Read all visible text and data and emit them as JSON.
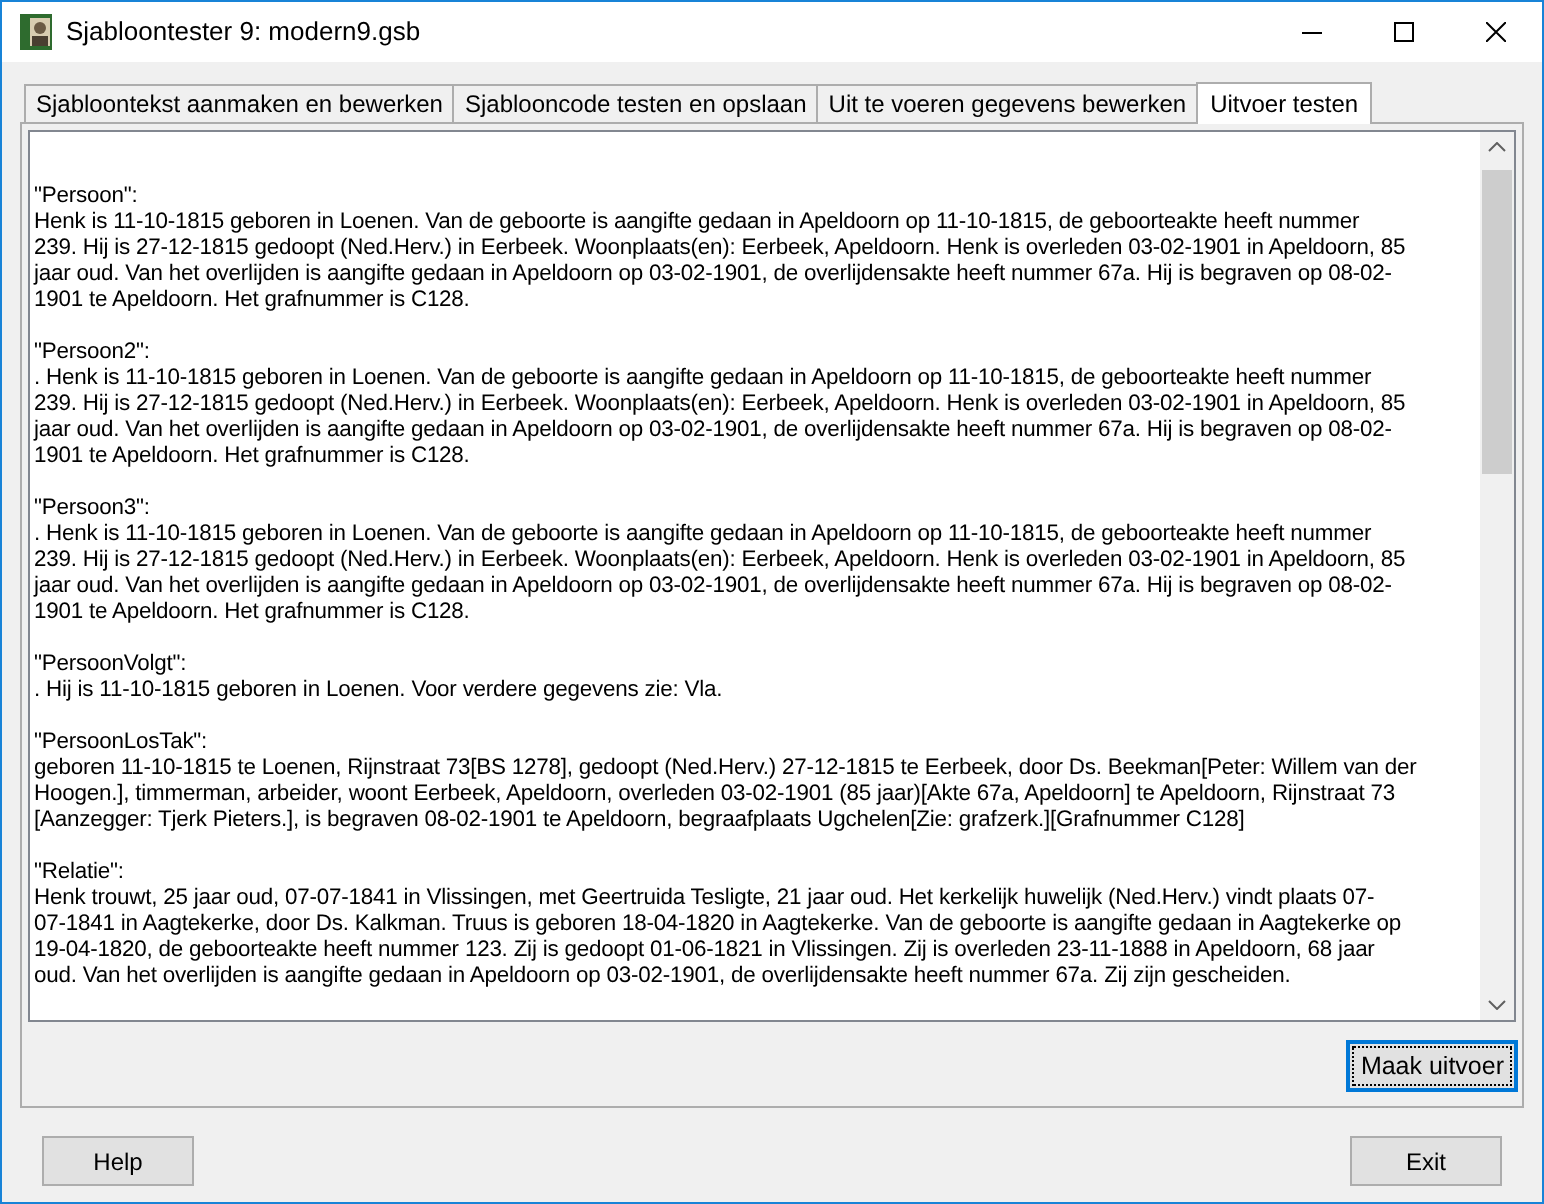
{
  "window": {
    "title": "Sjabloontester 9: modern9.gsb"
  },
  "tabs": [
    {
      "label": "Sjabloontekst aanmaken en bewerken",
      "selected": false
    },
    {
      "label": "Sjablooncode testen en opslaan",
      "selected": false
    },
    {
      "label": "Uit te voeren gegevens bewerken",
      "selected": false
    },
    {
      "label": "Uitvoer testen",
      "selected": true
    }
  ],
  "output": [
    {
      "heading": "\"Persoon\":",
      "lines": [
        "Henk is 11-10-1815 geboren in Loenen. Van de geboorte is aangifte gedaan in Apeldoorn op 11-10-1815, de geboorteakte heeft nummer",
        "239. Hij is 27-12-1815 gedoopt (Ned.Herv.) in Eerbeek. Woonplaats(en): Eerbeek, Apeldoorn. Henk is overleden 03-02-1901 in Apeldoorn, 85",
        "jaar oud. Van het overlijden is aangifte gedaan in Apeldoorn op 03-02-1901, de overlijdensakte heeft nummer 67a. Hij is begraven op 08-02-",
        "1901 te Apeldoorn. Het grafnummer is C128."
      ]
    },
    {
      "heading": "\"Persoon2\":",
      "lines": [
        ". Henk is 11-10-1815 geboren in Loenen. Van de geboorte is aangifte gedaan in Apeldoorn op 11-10-1815, de geboorteakte heeft nummer",
        "239. Hij is 27-12-1815 gedoopt (Ned.Herv.) in Eerbeek. Woonplaats(en): Eerbeek, Apeldoorn. Henk is overleden 03-02-1901 in Apeldoorn, 85",
        "jaar oud. Van het overlijden is aangifte gedaan in Apeldoorn op 03-02-1901, de overlijdensakte heeft nummer 67a. Hij is begraven op 08-02-",
        "1901 te Apeldoorn. Het grafnummer is C128."
      ]
    },
    {
      "heading": "\"Persoon3\":",
      "lines": [
        ". Henk is 11-10-1815 geboren in Loenen. Van de geboorte is aangifte gedaan in Apeldoorn op 11-10-1815, de geboorteakte heeft nummer",
        "239. Hij is 27-12-1815 gedoopt (Ned.Herv.) in Eerbeek. Woonplaats(en): Eerbeek, Apeldoorn. Henk is overleden 03-02-1901 in Apeldoorn, 85",
        "jaar oud. Van het overlijden is aangifte gedaan in Apeldoorn op 03-02-1901, de overlijdensakte heeft nummer 67a. Hij is begraven op 08-02-",
        "1901 te Apeldoorn. Het grafnummer is C128."
      ]
    },
    {
      "heading": "\"PersoonVolgt\":",
      "lines": [
        ". Hij is 11-10-1815 geboren in Loenen. Voor verdere gegevens zie: Vla."
      ]
    },
    {
      "heading": "\"PersoonLosTak\":",
      "lines": [
        "geboren 11-10-1815 te Loenen, Rijnstraat 73[BS 1278], gedoopt (Ned.Herv.) 27-12-1815 te Eerbeek, door Ds. Beekman[Peter: Willem van der",
        "Hoogen.], timmerman, arbeider, woont Eerbeek, Apeldoorn, overleden 03-02-1901 (85 jaar)[Akte 67a, Apeldoorn] te Apeldoorn, Rijnstraat 73",
        "[Aanzegger: Tjerk Pieters.], is begraven 08-02-1901 te Apeldoorn, begraafplaats Ugchelen[Zie: grafzerk.][Grafnummer C128]"
      ]
    },
    {
      "heading": "\"Relatie\":",
      "lines": [
        "Henk trouwt, 25 jaar oud, 07-07-1841 in Vlissingen, met Geertruida Tesligte, 21 jaar oud. Het kerkelijk huwelijk (Ned.Herv.) vindt plaats 07-",
        "07-1841 in Aagtekerke, door Ds. Kalkman. Truus is geboren 18-04-1820 in Aagtekerke. Van de geboorte is aangifte gedaan in Aagtekerke op",
        "19-04-1820, de geboorteakte heeft nummer 123. Zij is gedoopt 01-06-1821 in Vlissingen. Zij is overleden 23-11-1888 in Apeldoorn, 68 jaar",
        "oud. Van het overlijden is aangifte gedaan in Apeldoorn op 03-02-1901, de overlijdensakte heeft nummer 67a. Zij zijn gescheiden."
      ]
    }
  ],
  "run_button": "Maak uitvoer",
  "buttons": [
    "Help",
    "Exit"
  ]
}
